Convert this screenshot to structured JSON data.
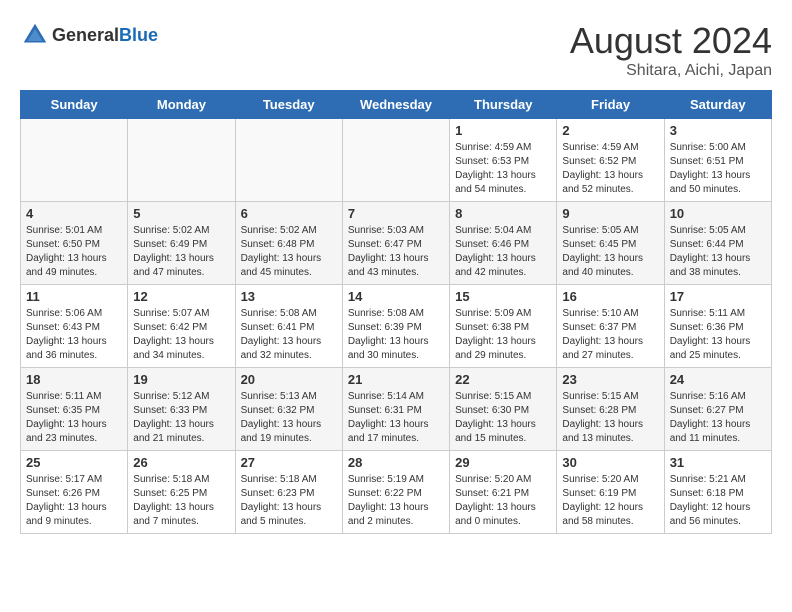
{
  "header": {
    "logo_general": "General",
    "logo_blue": "Blue",
    "month_title": "August 2024",
    "subtitle": "Shitara, Aichi, Japan"
  },
  "days_of_week": [
    "Sunday",
    "Monday",
    "Tuesday",
    "Wednesday",
    "Thursday",
    "Friday",
    "Saturday"
  ],
  "weeks": [
    [
      {
        "day": "",
        "info": ""
      },
      {
        "day": "",
        "info": ""
      },
      {
        "day": "",
        "info": ""
      },
      {
        "day": "",
        "info": ""
      },
      {
        "day": "1",
        "info": "Sunrise: 4:59 AM\nSunset: 6:53 PM\nDaylight: 13 hours\nand 54 minutes."
      },
      {
        "day": "2",
        "info": "Sunrise: 4:59 AM\nSunset: 6:52 PM\nDaylight: 13 hours\nand 52 minutes."
      },
      {
        "day": "3",
        "info": "Sunrise: 5:00 AM\nSunset: 6:51 PM\nDaylight: 13 hours\nand 50 minutes."
      }
    ],
    [
      {
        "day": "4",
        "info": "Sunrise: 5:01 AM\nSunset: 6:50 PM\nDaylight: 13 hours\nand 49 minutes."
      },
      {
        "day": "5",
        "info": "Sunrise: 5:02 AM\nSunset: 6:49 PM\nDaylight: 13 hours\nand 47 minutes."
      },
      {
        "day": "6",
        "info": "Sunrise: 5:02 AM\nSunset: 6:48 PM\nDaylight: 13 hours\nand 45 minutes."
      },
      {
        "day": "7",
        "info": "Sunrise: 5:03 AM\nSunset: 6:47 PM\nDaylight: 13 hours\nand 43 minutes."
      },
      {
        "day": "8",
        "info": "Sunrise: 5:04 AM\nSunset: 6:46 PM\nDaylight: 13 hours\nand 42 minutes."
      },
      {
        "day": "9",
        "info": "Sunrise: 5:05 AM\nSunset: 6:45 PM\nDaylight: 13 hours\nand 40 minutes."
      },
      {
        "day": "10",
        "info": "Sunrise: 5:05 AM\nSunset: 6:44 PM\nDaylight: 13 hours\nand 38 minutes."
      }
    ],
    [
      {
        "day": "11",
        "info": "Sunrise: 5:06 AM\nSunset: 6:43 PM\nDaylight: 13 hours\nand 36 minutes."
      },
      {
        "day": "12",
        "info": "Sunrise: 5:07 AM\nSunset: 6:42 PM\nDaylight: 13 hours\nand 34 minutes."
      },
      {
        "day": "13",
        "info": "Sunrise: 5:08 AM\nSunset: 6:41 PM\nDaylight: 13 hours\nand 32 minutes."
      },
      {
        "day": "14",
        "info": "Sunrise: 5:08 AM\nSunset: 6:39 PM\nDaylight: 13 hours\nand 30 minutes."
      },
      {
        "day": "15",
        "info": "Sunrise: 5:09 AM\nSunset: 6:38 PM\nDaylight: 13 hours\nand 29 minutes."
      },
      {
        "day": "16",
        "info": "Sunrise: 5:10 AM\nSunset: 6:37 PM\nDaylight: 13 hours\nand 27 minutes."
      },
      {
        "day": "17",
        "info": "Sunrise: 5:11 AM\nSunset: 6:36 PM\nDaylight: 13 hours\nand 25 minutes."
      }
    ],
    [
      {
        "day": "18",
        "info": "Sunrise: 5:11 AM\nSunset: 6:35 PM\nDaylight: 13 hours\nand 23 minutes."
      },
      {
        "day": "19",
        "info": "Sunrise: 5:12 AM\nSunset: 6:33 PM\nDaylight: 13 hours\nand 21 minutes."
      },
      {
        "day": "20",
        "info": "Sunrise: 5:13 AM\nSunset: 6:32 PM\nDaylight: 13 hours\nand 19 minutes."
      },
      {
        "day": "21",
        "info": "Sunrise: 5:14 AM\nSunset: 6:31 PM\nDaylight: 13 hours\nand 17 minutes."
      },
      {
        "day": "22",
        "info": "Sunrise: 5:15 AM\nSunset: 6:30 PM\nDaylight: 13 hours\nand 15 minutes."
      },
      {
        "day": "23",
        "info": "Sunrise: 5:15 AM\nSunset: 6:28 PM\nDaylight: 13 hours\nand 13 minutes."
      },
      {
        "day": "24",
        "info": "Sunrise: 5:16 AM\nSunset: 6:27 PM\nDaylight: 13 hours\nand 11 minutes."
      }
    ],
    [
      {
        "day": "25",
        "info": "Sunrise: 5:17 AM\nSunset: 6:26 PM\nDaylight: 13 hours\nand 9 minutes."
      },
      {
        "day": "26",
        "info": "Sunrise: 5:18 AM\nSunset: 6:25 PM\nDaylight: 13 hours\nand 7 minutes."
      },
      {
        "day": "27",
        "info": "Sunrise: 5:18 AM\nSunset: 6:23 PM\nDaylight: 13 hours\nand 5 minutes."
      },
      {
        "day": "28",
        "info": "Sunrise: 5:19 AM\nSunset: 6:22 PM\nDaylight: 13 hours\nand 2 minutes."
      },
      {
        "day": "29",
        "info": "Sunrise: 5:20 AM\nSunset: 6:21 PM\nDaylight: 13 hours\nand 0 minutes."
      },
      {
        "day": "30",
        "info": "Sunrise: 5:20 AM\nSunset: 6:19 PM\nDaylight: 12 hours\nand 58 minutes."
      },
      {
        "day": "31",
        "info": "Sunrise: 5:21 AM\nSunset: 6:18 PM\nDaylight: 12 hours\nand 56 minutes."
      }
    ]
  ]
}
